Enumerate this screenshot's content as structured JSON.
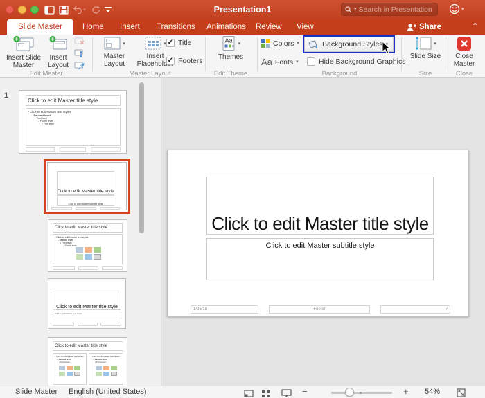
{
  "titlebar": {
    "title": "Presentation1",
    "search_placeholder": "Search in Presentation"
  },
  "tabs": {
    "slide_master": "Slide Master",
    "home": "Home",
    "insert": "Insert",
    "transitions": "Transitions",
    "animations": "Animations",
    "review": "Review",
    "view": "View",
    "share": "Share"
  },
  "ribbon": {
    "edit_master": {
      "insert_slide_master": "Insert Slide Master",
      "insert_layout": "Insert Layout",
      "group_label": "Edit Master"
    },
    "master_layout": {
      "master_layout": "Master Layout",
      "insert_placeholder": "Insert Placeholder",
      "title_checkbox": "Title",
      "footers_checkbox": "Footers",
      "group_label": "Master Layout"
    },
    "edit_theme": {
      "themes": "Themes",
      "group_label": "Edit Theme"
    },
    "background": {
      "colors": "Colors",
      "fonts": "Fonts",
      "fonts_glyph": "Aa",
      "background_styles": "Background Styles",
      "hide_background_graphics": "Hide Background Graphics",
      "group_label": "Background"
    },
    "size": {
      "slide_size": "Slide Size",
      "group_label": "Size"
    },
    "close": {
      "close_master": "Close Master",
      "group_label": "Close"
    }
  },
  "thumbnails": {
    "master": {
      "number": "1",
      "title": "Click to edit Master title style",
      "bullets": [
        "Click to edit Master text styles",
        "Second level",
        "Third level",
        "Fourth level",
        "Fifth level"
      ]
    },
    "title_slide": {
      "title": "Click to edit Master title style",
      "subtitle": "Click to edit Master subtitle style"
    },
    "title_content": {
      "title": "Click to edit Master title style",
      "bullets": [
        "Click to edit Master text styles",
        "Second level",
        "Third level",
        "Fourth level"
      ]
    },
    "section_header": {
      "title": "Click to edit Master title style",
      "text": "Click to edit Master text styles"
    },
    "two_content": {
      "title": "Click to edit Master title style",
      "bullets_left": [
        "Click to edit Master text styles",
        "Second level",
        "Third level"
      ],
      "bullets_right": [
        "Click to edit Master text styles",
        "Second level",
        "Third level"
      ]
    }
  },
  "slide": {
    "title": "Click to edit Master title style",
    "subtitle": "Click to edit Master subtitle style",
    "date": "1/25/18",
    "footer": "Footer",
    "slide_number": "#"
  },
  "statusbar": {
    "view": "Slide Master",
    "language": "English (United States)",
    "zoom": "54%"
  },
  "icons": {
    "caret": "▾",
    "check": "✓",
    "chevron_up": "⌃",
    "minus": "−",
    "plus": "+"
  },
  "colors": {
    "accent_red": "#c43e1c",
    "selection_orange": "#d3431f",
    "highlight_blue": "#1c2fc2"
  }
}
